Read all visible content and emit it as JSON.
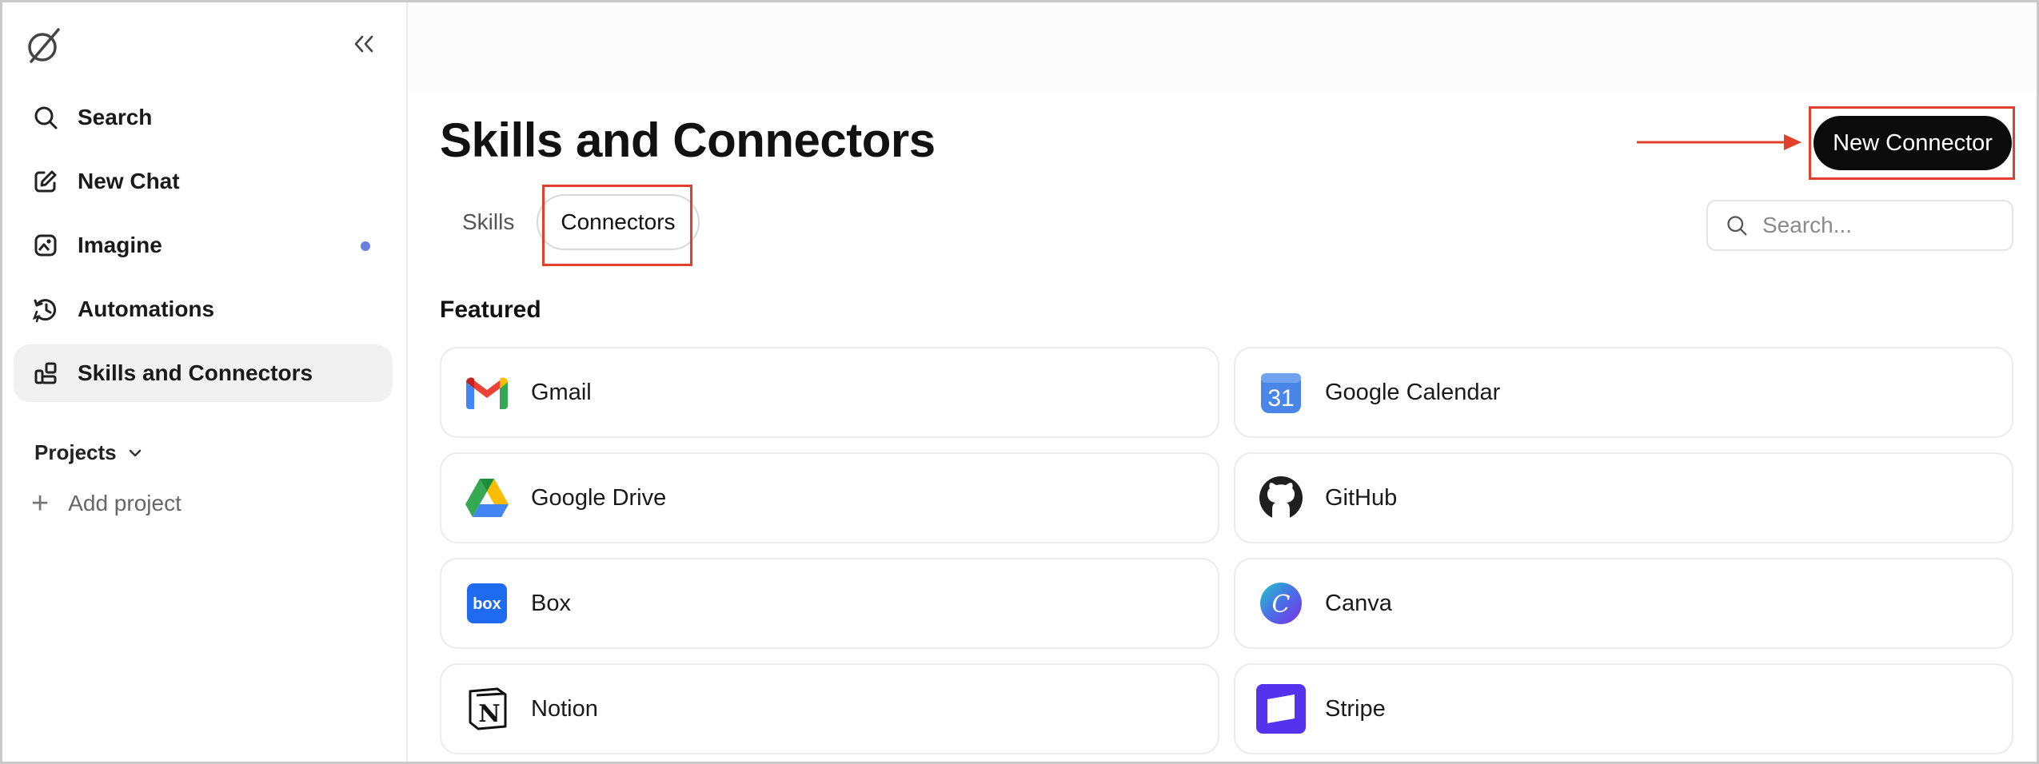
{
  "sidebar": {
    "collapse_label": "«",
    "items": [
      {
        "label": "Search",
        "icon": "search-icon"
      },
      {
        "label": "New Chat",
        "icon": "edit-icon"
      },
      {
        "label": "Imagine",
        "icon": "imagine-icon"
      },
      {
        "label": "Automations",
        "icon": "automations-icon"
      },
      {
        "label": "Skills and Connectors",
        "icon": "grid-icon"
      }
    ],
    "projects_label": "Projects",
    "add_project_label": "Add project"
  },
  "main": {
    "title": "Skills and Connectors",
    "new_connector_label": "New Connector",
    "tabs": [
      {
        "label": "Skills"
      },
      {
        "label": "Connectors"
      }
    ],
    "search_placeholder": "Search...",
    "featured_label": "Featured",
    "connectors": [
      {
        "name": "Gmail",
        "icon": "gmail-icon"
      },
      {
        "name": "Google Calendar",
        "icon": "google-calendar-icon",
        "badge": "31"
      },
      {
        "name": "Google Drive",
        "icon": "google-drive-icon"
      },
      {
        "name": "GitHub",
        "icon": "github-icon"
      },
      {
        "name": "Box",
        "icon": "box-icon",
        "badge": "box"
      },
      {
        "name": "Canva",
        "icon": "canva-icon",
        "badge": "C"
      },
      {
        "name": "Notion",
        "icon": "notion-icon",
        "badge": "N"
      },
      {
        "name": "Stripe",
        "icon": "stripe-icon"
      }
    ]
  },
  "colors": {
    "accent_dot": "#6b7fe0",
    "highlight": "#e0402c",
    "primary_button": "#0b0b0b"
  }
}
